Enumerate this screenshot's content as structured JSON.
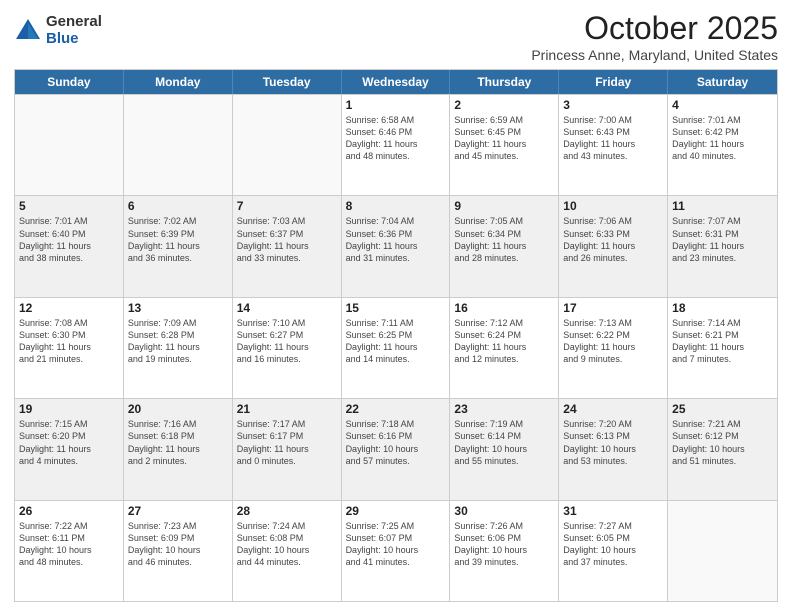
{
  "logo": {
    "general": "General",
    "blue": "Blue"
  },
  "title": "October 2025",
  "subtitle": "Princess Anne, Maryland, United States",
  "days": [
    "Sunday",
    "Monday",
    "Tuesday",
    "Wednesday",
    "Thursday",
    "Friday",
    "Saturday"
  ],
  "rows": [
    [
      {
        "day": "",
        "info": "",
        "empty": true
      },
      {
        "day": "",
        "info": "",
        "empty": true
      },
      {
        "day": "",
        "info": "",
        "empty": true
      },
      {
        "day": "1",
        "info": "Sunrise: 6:58 AM\nSunset: 6:46 PM\nDaylight: 11 hours\nand 48 minutes."
      },
      {
        "day": "2",
        "info": "Sunrise: 6:59 AM\nSunset: 6:45 PM\nDaylight: 11 hours\nand 45 minutes."
      },
      {
        "day": "3",
        "info": "Sunrise: 7:00 AM\nSunset: 6:43 PM\nDaylight: 11 hours\nand 43 minutes."
      },
      {
        "day": "4",
        "info": "Sunrise: 7:01 AM\nSunset: 6:42 PM\nDaylight: 11 hours\nand 40 minutes."
      }
    ],
    [
      {
        "day": "5",
        "info": "Sunrise: 7:01 AM\nSunset: 6:40 PM\nDaylight: 11 hours\nand 38 minutes.",
        "shaded": true
      },
      {
        "day": "6",
        "info": "Sunrise: 7:02 AM\nSunset: 6:39 PM\nDaylight: 11 hours\nand 36 minutes.",
        "shaded": true
      },
      {
        "day": "7",
        "info": "Sunrise: 7:03 AM\nSunset: 6:37 PM\nDaylight: 11 hours\nand 33 minutes.",
        "shaded": true
      },
      {
        "day": "8",
        "info": "Sunrise: 7:04 AM\nSunset: 6:36 PM\nDaylight: 11 hours\nand 31 minutes.",
        "shaded": true
      },
      {
        "day": "9",
        "info": "Sunrise: 7:05 AM\nSunset: 6:34 PM\nDaylight: 11 hours\nand 28 minutes.",
        "shaded": true
      },
      {
        "day": "10",
        "info": "Sunrise: 7:06 AM\nSunset: 6:33 PM\nDaylight: 11 hours\nand 26 minutes.",
        "shaded": true
      },
      {
        "day": "11",
        "info": "Sunrise: 7:07 AM\nSunset: 6:31 PM\nDaylight: 11 hours\nand 23 minutes.",
        "shaded": true
      }
    ],
    [
      {
        "day": "12",
        "info": "Sunrise: 7:08 AM\nSunset: 6:30 PM\nDaylight: 11 hours\nand 21 minutes."
      },
      {
        "day": "13",
        "info": "Sunrise: 7:09 AM\nSunset: 6:28 PM\nDaylight: 11 hours\nand 19 minutes."
      },
      {
        "day": "14",
        "info": "Sunrise: 7:10 AM\nSunset: 6:27 PM\nDaylight: 11 hours\nand 16 minutes."
      },
      {
        "day": "15",
        "info": "Sunrise: 7:11 AM\nSunset: 6:25 PM\nDaylight: 11 hours\nand 14 minutes."
      },
      {
        "day": "16",
        "info": "Sunrise: 7:12 AM\nSunset: 6:24 PM\nDaylight: 11 hours\nand 12 minutes."
      },
      {
        "day": "17",
        "info": "Sunrise: 7:13 AM\nSunset: 6:22 PM\nDaylight: 11 hours\nand 9 minutes."
      },
      {
        "day": "18",
        "info": "Sunrise: 7:14 AM\nSunset: 6:21 PM\nDaylight: 11 hours\nand 7 minutes."
      }
    ],
    [
      {
        "day": "19",
        "info": "Sunrise: 7:15 AM\nSunset: 6:20 PM\nDaylight: 11 hours\nand 4 minutes.",
        "shaded": true
      },
      {
        "day": "20",
        "info": "Sunrise: 7:16 AM\nSunset: 6:18 PM\nDaylight: 11 hours\nand 2 minutes.",
        "shaded": true
      },
      {
        "day": "21",
        "info": "Sunrise: 7:17 AM\nSunset: 6:17 PM\nDaylight: 11 hours\nand 0 minutes.",
        "shaded": true
      },
      {
        "day": "22",
        "info": "Sunrise: 7:18 AM\nSunset: 6:16 PM\nDaylight: 10 hours\nand 57 minutes.",
        "shaded": true
      },
      {
        "day": "23",
        "info": "Sunrise: 7:19 AM\nSunset: 6:14 PM\nDaylight: 10 hours\nand 55 minutes.",
        "shaded": true
      },
      {
        "day": "24",
        "info": "Sunrise: 7:20 AM\nSunset: 6:13 PM\nDaylight: 10 hours\nand 53 minutes.",
        "shaded": true
      },
      {
        "day": "25",
        "info": "Sunrise: 7:21 AM\nSunset: 6:12 PM\nDaylight: 10 hours\nand 51 minutes.",
        "shaded": true
      }
    ],
    [
      {
        "day": "26",
        "info": "Sunrise: 7:22 AM\nSunset: 6:11 PM\nDaylight: 10 hours\nand 48 minutes."
      },
      {
        "day": "27",
        "info": "Sunrise: 7:23 AM\nSunset: 6:09 PM\nDaylight: 10 hours\nand 46 minutes."
      },
      {
        "day": "28",
        "info": "Sunrise: 7:24 AM\nSunset: 6:08 PM\nDaylight: 10 hours\nand 44 minutes."
      },
      {
        "day": "29",
        "info": "Sunrise: 7:25 AM\nSunset: 6:07 PM\nDaylight: 10 hours\nand 41 minutes."
      },
      {
        "day": "30",
        "info": "Sunrise: 7:26 AM\nSunset: 6:06 PM\nDaylight: 10 hours\nand 39 minutes."
      },
      {
        "day": "31",
        "info": "Sunrise: 7:27 AM\nSunset: 6:05 PM\nDaylight: 10 hours\nand 37 minutes."
      },
      {
        "day": "",
        "info": "",
        "empty": true
      }
    ]
  ]
}
